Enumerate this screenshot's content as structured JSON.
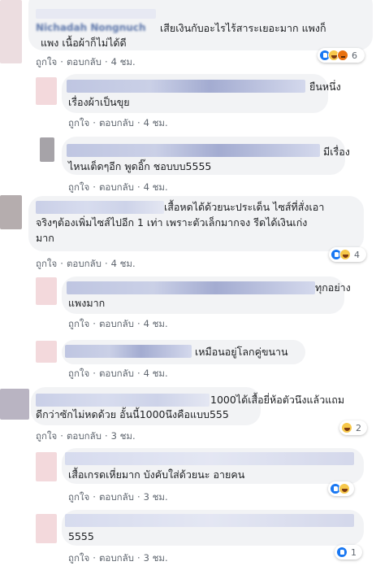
{
  "ui": {
    "like_label": "ถูกใจ",
    "reply_label": "ตอบกลับ",
    "separator": "·"
  },
  "colors": {
    "bubble": "#f2f3f5",
    "link": "#606770",
    "like": "#1877f2",
    "haha": "#f7c84a",
    "love": "#f33e58",
    "angry": "#e9710f"
  },
  "comments": [
    {
      "author": "Nichadah Nongnuch",
      "lines": [
        "เสียเงินกับอะไรไร้สาระเยอะมาก แพงก็",
        "แพง เนื้อผ้าก็ไม่ได้ดี"
      ],
      "time": "4 ชม.",
      "reactions": {
        "icons": [
          "like-emoji",
          "haha-emoji",
          "angry-emoji"
        ],
        "count": "6"
      }
    },
    {
      "lines": [
        "ยืนหนึ่ง",
        "เรื่องผ้าเป็นขุย"
      ],
      "time": "4 ชม."
    },
    {
      "lines": [
        "มีเรื่อง",
        "ไหนเต็ดๆอีก พูดอิ๊ก ชอบบบ5555"
      ],
      "time": "4 ชม."
    },
    {
      "lines": [
        "เสื้อหดได้ด้วยนะประเด็น ไซส์ที่สั่งเอา",
        "จริงๆต้องเพิ่มไซส์ไปอีก 1 เท่า เพราะตัวเล็กมากจง รีดได้เงินเก่ง",
        "มาก"
      ],
      "time": "4 ชม.",
      "reactions": {
        "icons": [
          "like-emoji",
          "haha-emoji"
        ],
        "count": "4"
      }
    },
    {
      "lines": [
        "ทุกอย่าง",
        "แพงมาก"
      ],
      "time": "4 ชม."
    },
    {
      "lines": [
        "เหมือนอยู่โลกคู่ขนาน"
      ],
      "time": "4 ชม."
    },
    {
      "lines": [
        "1000ได้เสื้อยี่ห้อตัวนึงแล้วแถม",
        "ดีกว่าซักไม่หดด้วย อั้นนี้1000นึงคือแบบ555"
      ],
      "time": "3 ชม.",
      "reactions": {
        "icons": [
          "haha-emoji"
        ],
        "count": "2"
      }
    },
    {
      "lines": [
        "เสื้อเกรดเหี่ยมาก บังคับใส่ด้วยนะ อายคน"
      ],
      "time": "3 ชม.",
      "reactions": {
        "icons": [
          "like-emoji",
          "haha-emoji"
        ],
        "count": ""
      }
    },
    {
      "lines": [
        "5555"
      ],
      "time": "3 ชม.",
      "reactions": {
        "icons": [
          "like-emoji"
        ],
        "count": "1"
      }
    }
  ]
}
